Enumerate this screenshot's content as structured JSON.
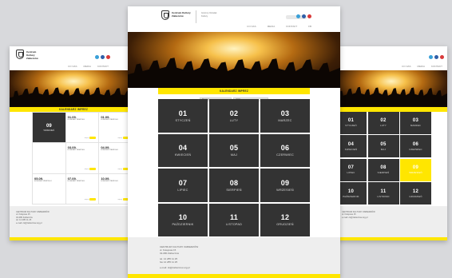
{
  "brand": {
    "logo_title": "Centrum Kultury Zabierzów",
    "logo_sub": "Gminny Ośrodek Kultury",
    "social_colors": [
      "#3aa0d8",
      "#2f5fa8",
      "#d93a3a"
    ]
  },
  "nav": [
    "CO NAS",
    "MEDIA",
    "KONTAKT",
    "FB"
  ],
  "section_title": "KALENDARZ IMPREZ",
  "filter": {
    "month": "Miesiąc",
    "year": "2015"
  },
  "months": [
    {
      "num": "01",
      "name": "STYCZEŃ"
    },
    {
      "num": "02",
      "name": "LUTY"
    },
    {
      "num": "03",
      "name": "MARZEC"
    },
    {
      "num": "04",
      "name": "KWIECIEŃ"
    },
    {
      "num": "05",
      "name": "MAJ"
    },
    {
      "num": "06",
      "name": "CZERWIEC"
    },
    {
      "num": "07",
      "name": "LIPIEC"
    },
    {
      "num": "08",
      "name": "SIERPIEŃ"
    },
    {
      "num": "09",
      "name": "WRZESIEŃ"
    },
    {
      "num": "10",
      "name": "PAŹDZIERNIK"
    },
    {
      "num": "11",
      "name": "LISTOPAD"
    },
    {
      "num": "12",
      "name": "GRUDZIEŃ"
    }
  ],
  "calendar": {
    "current_day": "09",
    "current_month": "WRZESIEŃ",
    "events": [
      {
        "date": "01.09.",
        "title": "KONCERT ZESPOŁU"
      },
      {
        "date": "01.09.",
        "title": "KONCERT ZESPOŁU"
      },
      {
        "date": "03.09.",
        "title": "KONCERT ZESPOŁU"
      },
      {
        "date": "04.09.",
        "title": "KONCERT ZESPOŁU"
      },
      {
        "date": "05.09.",
        "title": "KONCERT ZESPOŁU"
      },
      {
        "date": "07.09.",
        "title": "KONCERT ZESPOŁU"
      },
      {
        "date": "10.09.",
        "title": "KONCERT ZESPOŁU"
      }
    ],
    "more_label": "więcej"
  },
  "footer": {
    "lines": [
      "CENTRUM KULTURY ZABIERZÓW",
      "ul. Kolejowa 15",
      "32-080 Zabierzów",
      "",
      "tel. 12 285 11 25",
      "fax 12 285 11 25",
      "",
      "e-mail: ck@zabierzow.org.pl"
    ]
  },
  "colors": {
    "accent": "#ffe600",
    "tile": "#333333",
    "background": "#d8d9dc"
  }
}
